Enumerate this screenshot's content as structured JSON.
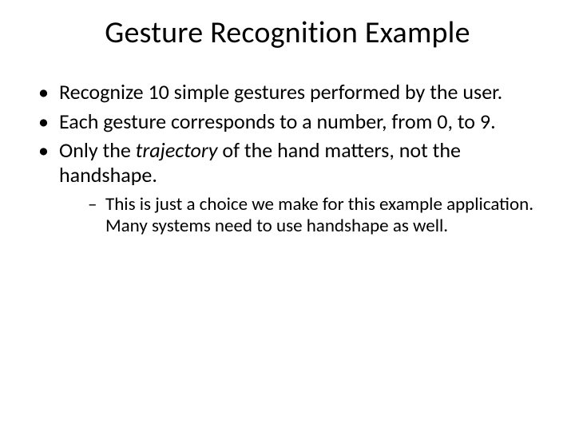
{
  "title": "Gesture Recognition Example",
  "bullets": [
    {
      "text": "Recognize 10 simple gestures performed by the user."
    },
    {
      "text": "Each gesture corresponds to a number, from 0, to 9."
    },
    {
      "pre": "Only the ",
      "em": "trajectory",
      "post": " of the hand matters, not the handshape.",
      "sub": [
        "This is just a choice we make for this example application. Many systems need to use handshape as well."
      ]
    }
  ]
}
